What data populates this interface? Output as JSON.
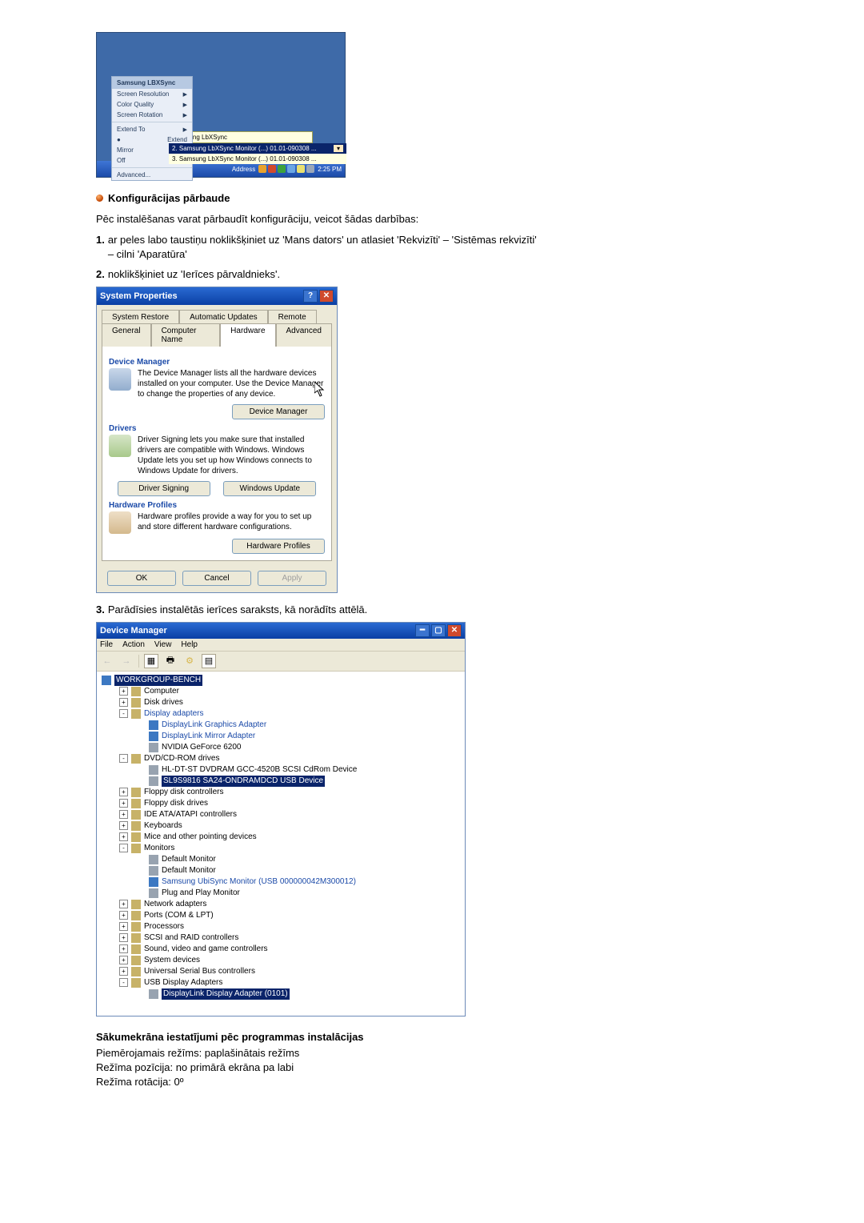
{
  "shot1": {
    "menu_header": "Samsung LBXSync",
    "menu_items": [
      {
        "label": "Screen Resolution",
        "arrow": true
      },
      {
        "label": "Color Quality",
        "arrow": true
      },
      {
        "label": "Screen Rotation",
        "arrow": true
      },
      {
        "label": "Extend To",
        "arrow": true
      },
      {
        "label": "Extend",
        "arrow": false,
        "bullet": true
      },
      {
        "label": "Mirror",
        "arrow": false
      },
      {
        "label": "Off",
        "arrow": false
      },
      {
        "label": "Advanced...",
        "arrow": false
      }
    ],
    "tooltip_text": "Samsung LbXSync",
    "dropdown_selected": "2. Samsung LbXSync Monitor (...) 01.01-090308 ...",
    "dropdown_option": "3. Samsung LbXSync Monitor (...) 01.01-090308 ...",
    "taskbar_address_label": "Address",
    "taskbar_clock": "2:25 PM"
  },
  "section1": {
    "title": "Konfigurācijas pārbaude",
    "intro": "Pēc instalēšanas varat pārbaudīt konfigurāciju, veicot šādas darbības:",
    "step1_num": "1.",
    "step1_text": "ar peles labo taustiņu noklikšķiniet uz 'Mans dators' un atlasiet 'Rekvizīti' – 'Sistēmas rekvizīti' – cilni 'Aparatūra'",
    "step2_num": "2.",
    "step2_text": "noklikšķiniet uz 'Ierīces pārvaldnieks'."
  },
  "sysprops": {
    "title": "System Properties",
    "tabs_row1": [
      "System Restore",
      "Automatic Updates",
      "Remote"
    ],
    "tabs_row2": [
      "General",
      "Computer Name",
      "Hardware",
      "Advanced"
    ],
    "active_tab": "Hardware",
    "dm_label": "Device Manager",
    "dm_text": "The Device Manager lists all the hardware devices installed on your computer. Use the Device Manager to change the properties of any device.",
    "dm_button": "Device Manager",
    "drv_label": "Drivers",
    "drv_text": "Driver Signing lets you make sure that installed drivers are compatible with Windows. Windows Update lets you set up how Windows connects to Windows Update for drivers.",
    "drv_btn1": "Driver Signing",
    "drv_btn2": "Windows Update",
    "hp_label": "Hardware Profiles",
    "hp_text": "Hardware profiles provide a way for you to set up and store different hardware configurations.",
    "hp_button": "Hardware Profiles",
    "ok": "OK",
    "cancel": "Cancel",
    "apply": "Apply"
  },
  "step3_num": "3.",
  "step3_text": "Parādīsies instalētās ierīces saraksts, kā norādīts attēlā.",
  "devmgr": {
    "title": "Device Manager",
    "menubar": [
      "File",
      "Action",
      "View",
      "Help"
    ],
    "root": "WORKGROUP-BENCH",
    "nodes": [
      {
        "label": "Computer",
        "expand": "+"
      },
      {
        "label": "Disk drives",
        "expand": "+"
      },
      {
        "label": "Display adapters",
        "expand": "-",
        "blue": true,
        "children": [
          {
            "label": "DisplayLink Graphics Adapter",
            "blue": true
          },
          {
            "label": "DisplayLink Mirror Adapter",
            "blue": true
          },
          {
            "label": "NVIDIA GeForce 6200"
          }
        ]
      },
      {
        "label": "DVD/CD-ROM drives",
        "expand": "-",
        "children": [
          {
            "label": "HL-DT-ST DVDRAM GCC-4520B SCSI CdRom Device"
          },
          {
            "label": "SL9S9816 SA24-ONDRAMDCD USB Device",
            "highlight": true
          }
        ]
      },
      {
        "label": "Floppy disk controllers",
        "expand": "+"
      },
      {
        "label": "Floppy disk drives",
        "expand": "+"
      },
      {
        "label": "IDE ATA/ATAPI controllers",
        "expand": "+"
      },
      {
        "label": "Keyboards",
        "expand": "+"
      },
      {
        "label": "Mice and other pointing devices",
        "expand": "+"
      },
      {
        "label": "Monitors",
        "expand": "-",
        "children": [
          {
            "label": "Default Monitor"
          },
          {
            "label": "Default Monitor"
          },
          {
            "label": "Samsung UbiSync Monitor (USB 000000042M300012)",
            "blue": true
          },
          {
            "label": "Plug and Play Monitor"
          }
        ]
      },
      {
        "label": "Network adapters",
        "expand": "+"
      },
      {
        "label": "Ports (COM & LPT)",
        "expand": "+"
      },
      {
        "label": "Processors",
        "expand": "+"
      },
      {
        "label": "SCSI and RAID controllers",
        "expand": "+"
      },
      {
        "label": "Sound, video and game controllers",
        "expand": "+"
      },
      {
        "label": "System devices",
        "expand": "+"
      },
      {
        "label": "Universal Serial Bus controllers",
        "expand": "+"
      },
      {
        "label": "USB Display Adapters",
        "expand": "-",
        "children": [
          {
            "label": "DisplayLink Display Adapter (0101)",
            "highlight": true
          }
        ]
      }
    ]
  },
  "section2": {
    "title": "Sākumekrāna iestatījumi pēc programmas instalācijas",
    "line1": "Piemērojamais režīms: paplašinātais režīms",
    "line2": "Režīma pozīcija: no primārā ekrāna pa labi",
    "line3": "Režīma rotācija: 0º"
  }
}
